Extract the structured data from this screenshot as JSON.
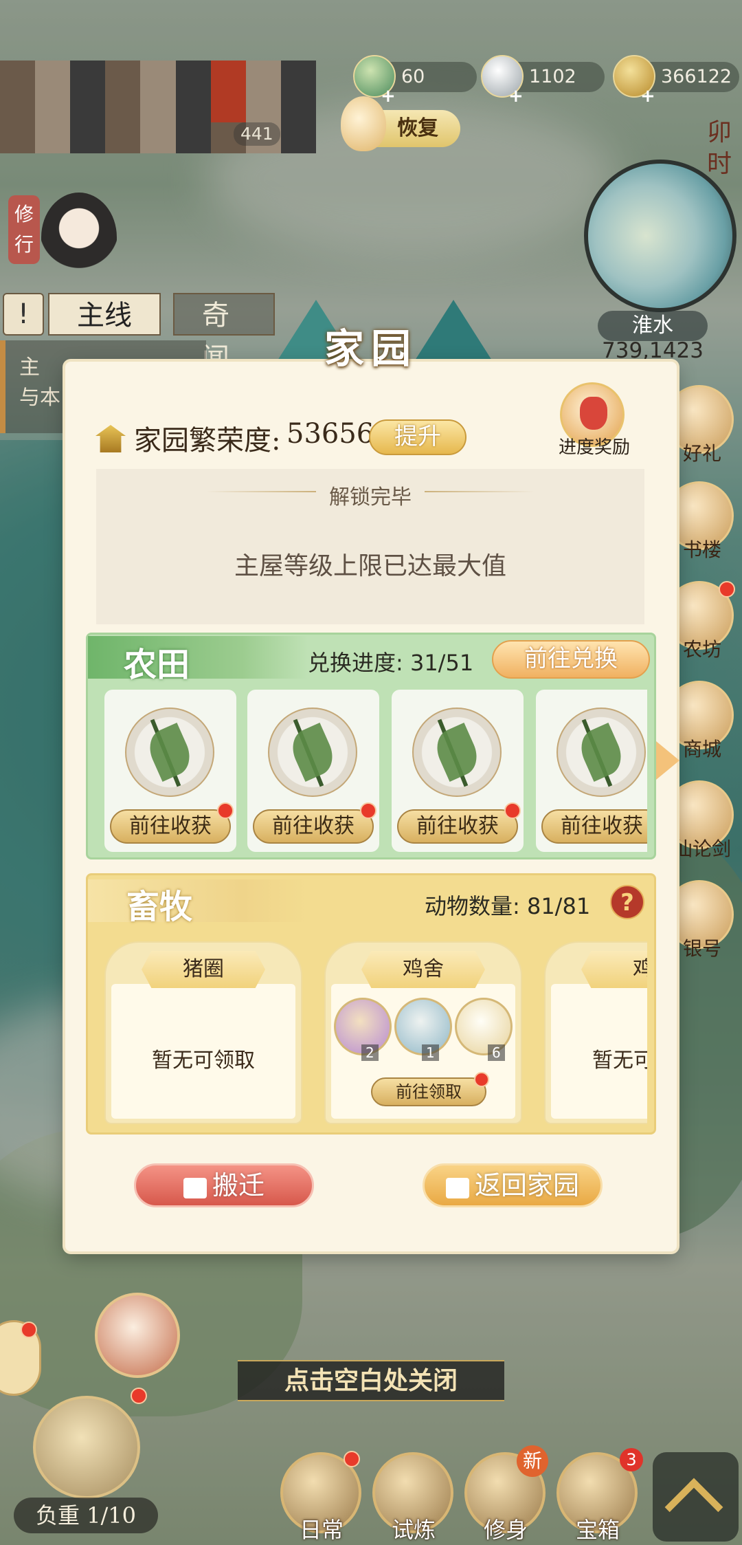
{
  "hud": {
    "resources": [
      {
        "icon": "jade-icon",
        "value": "60"
      },
      {
        "icon": "silver-ingot-icon",
        "value": "1102"
      },
      {
        "icon": "copper-coin-icon",
        "value": "366122"
      }
    ],
    "restore_label": "恢复",
    "stat_value": "441",
    "time_label": "卯时",
    "region_name": "淮水",
    "coordinates": "739,1423",
    "cultivate_label": "修行"
  },
  "quest": {
    "tab_main": "主线",
    "tab_side": "奇闻",
    "line1": "主",
    "line2": "与本"
  },
  "side_menu": [
    {
      "label": "好礼",
      "icon": "gift-icon"
    },
    {
      "label": "书楼",
      "icon": "bookhouse-icon"
    },
    {
      "label": "农坊",
      "icon": "farm-workshop-icon"
    },
    {
      "label": "商城",
      "icon": "shop-icon"
    },
    {
      "label": "仙论剑",
      "icon": "sword-icon"
    },
    {
      "label": "银号",
      "icon": "bank-icon"
    }
  ],
  "modal": {
    "title": "家园",
    "prosperity_label": "家园繁荣度:",
    "prosperity_value": "53656",
    "upgrade_label": "提升",
    "reward_label": "进度奖励",
    "unlock_header": "解锁完毕",
    "unlock_message": "主屋等级上限已达最大值",
    "farmland": {
      "title": "农田",
      "progress_label": "兑换进度: 31/51",
      "exchange_button": "前往兑换",
      "plots": [
        {
          "button": "前往收获"
        },
        {
          "button": "前往收获"
        },
        {
          "button": "前往收获"
        },
        {
          "button": "前往收获"
        }
      ]
    },
    "livestock": {
      "title": "畜牧",
      "count_label": "动物数量: 81/81",
      "help": "?",
      "pens": [
        {
          "name": "猪圈",
          "status": "暂无可领取"
        },
        {
          "name": "鸡舍",
          "goods": [
            {
              "icon": "worm-icon",
              "count": "2"
            },
            {
              "icon": "seed-bag-icon",
              "count": "1"
            },
            {
              "icon": "egg-icon",
              "count": "6"
            }
          ],
          "button": "前往领取"
        },
        {
          "name": "鸡",
          "status": "暂无可"
        }
      ]
    },
    "relocate_button": "搬迁",
    "return_button": "返回家园"
  },
  "close_hint": "点击空白处关闭",
  "bottom_bar": {
    "weight_label": "负重 1/10",
    "buttons": [
      {
        "label": "日常",
        "icon": "daily-icon"
      },
      {
        "label": "试炼",
        "icon": "trial-icon"
      },
      {
        "label": "修身",
        "icon": "cultivation-icon"
      },
      {
        "label": "宝箱",
        "icon": "treasure-chest-icon"
      }
    ],
    "new_badge": "新",
    "chest_badge": "3"
  }
}
